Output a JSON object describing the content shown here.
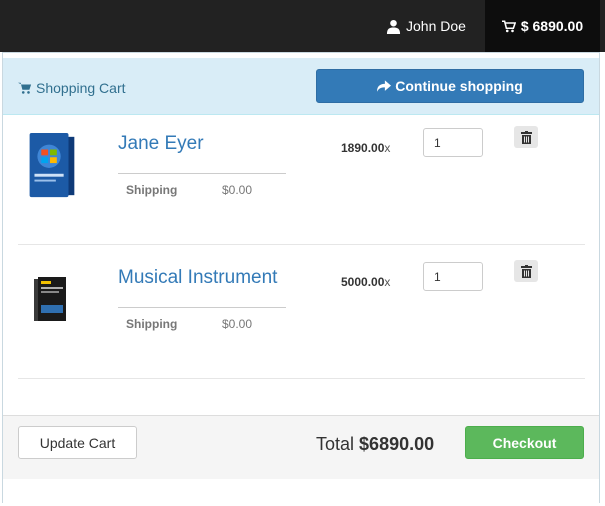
{
  "nav": {
    "user_name": "John Doe",
    "cart_total": "$ 6890.00",
    "icons": {
      "user": "user-icon",
      "cart": "cart-icon"
    }
  },
  "cart": {
    "title": "Shopping Cart",
    "continue_label": "Continue shopping",
    "items": [
      {
        "name": "Jane Eyer",
        "shipping_label": "Shipping",
        "shipping_value": "$0.00",
        "price": "1890.00",
        "multiplier": "x",
        "quantity": "1"
      },
      {
        "name": "Musical Instrument",
        "shipping_label": "Shipping",
        "shipping_value": "$0.00",
        "price": "5000.00",
        "multiplier": "x",
        "quantity": "1"
      }
    ],
    "footer": {
      "update_label": "Update Cart",
      "total_label": "Total",
      "total_value": "$6890.00",
      "checkout_label": "Checkout"
    }
  },
  "colors": {
    "navbar": "#222222",
    "panel_heading": "#d9edf7",
    "primary": "#337ab7",
    "success": "#5cb85c"
  }
}
